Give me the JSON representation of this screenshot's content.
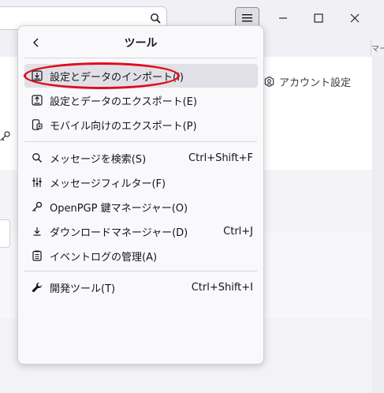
{
  "window": {
    "account_settings": "アカウント設定",
    "tab_fragment": "マー"
  },
  "menu": {
    "title": "ツール",
    "items": [
      {
        "label": "設定とデータのインポート(I)",
        "shortcut": "",
        "icon": "import-icon"
      },
      {
        "label": "設定とデータのエクスポート(E)",
        "shortcut": "",
        "icon": "export-icon"
      },
      {
        "label": "モバイル向けのエクスポート(P)",
        "shortcut": "",
        "icon": "mobile-export-icon"
      },
      {
        "label": "メッセージを検索(S)",
        "shortcut": "Ctrl+Shift+F",
        "icon": "search-icon"
      },
      {
        "label": "メッセージフィルター(F)",
        "shortcut": "",
        "icon": "filter-icon"
      },
      {
        "label": "OpenPGP 鍵マネージャー(O)",
        "shortcut": "",
        "icon": "key-icon"
      },
      {
        "label": "ダウンロードマネージャー(D)",
        "shortcut": "Ctrl+J",
        "icon": "download-icon"
      },
      {
        "label": "イベントログの管理(A)",
        "shortcut": "",
        "icon": "activity-log-icon"
      },
      {
        "label": "開発ツール(T)",
        "shortcut": "Ctrl+Shift+I",
        "icon": "wrench-icon"
      }
    ]
  },
  "colors": {
    "highlight": "#e0e0e6",
    "annotation": "#e00d1e",
    "panel_bg": "#f9f9fb"
  }
}
